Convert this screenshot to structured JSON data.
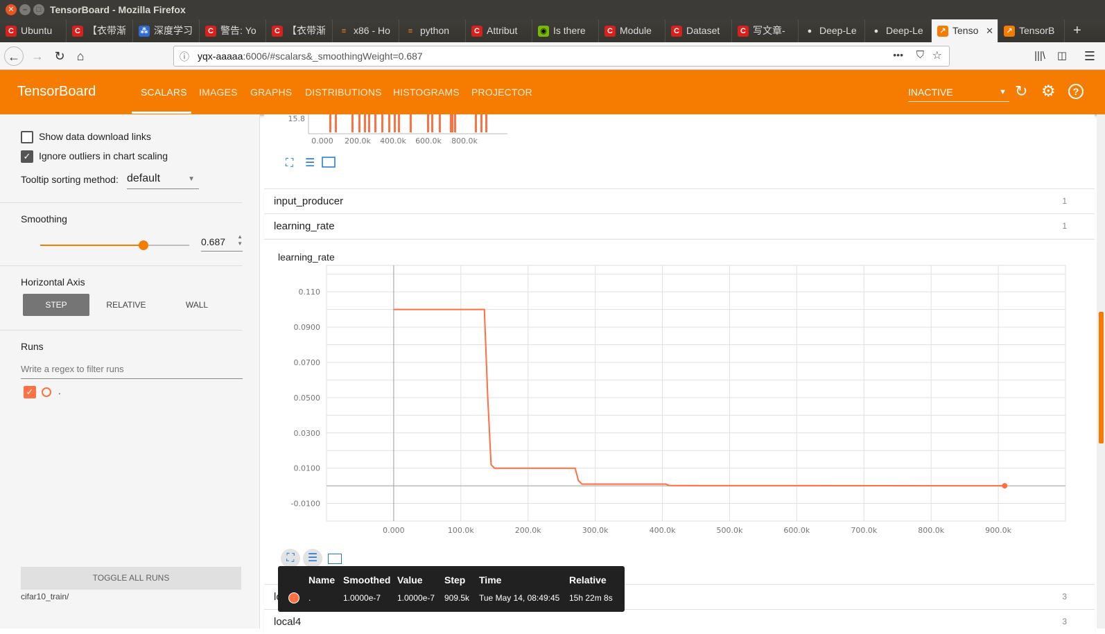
{
  "window": {
    "title": "TensorBoard - Mozilla Firefox"
  },
  "browser": {
    "tabs": [
      {
        "label": "Ubuntu",
        "icon": "csdn-icon"
      },
      {
        "label": "【衣带渐",
        "icon": "csdn-icon"
      },
      {
        "label": "深度学习",
        "icon": "baidu-icon"
      },
      {
        "label": "警告: Yo",
        "icon": "csdn-icon"
      },
      {
        "label": "【衣带渐",
        "icon": "csdn-icon"
      },
      {
        "label": "x86 - Ho",
        "icon": "stackoverflow-icon"
      },
      {
        "label": "python",
        "icon": "stackoverflow-icon"
      },
      {
        "label": "Attribut",
        "icon": "csdn-icon"
      },
      {
        "label": "Is there",
        "icon": "nvidia-icon"
      },
      {
        "label": "Module",
        "icon": "csdn-icon"
      },
      {
        "label": "Dataset",
        "icon": "csdn-icon"
      },
      {
        "label": "写文章-",
        "icon": "csdn-icon"
      },
      {
        "label": "Deep-Le",
        "icon": "github-icon"
      },
      {
        "label": "Deep-Le",
        "icon": "github-icon"
      },
      {
        "label": "Tenso",
        "icon": "tensorboard-icon"
      },
      {
        "label": "TensorB",
        "icon": "tensorboard-icon"
      }
    ],
    "url_host": "yqx-aaaaa",
    "url_rest": ":6006/#scalars&_smoothingWeight=0.687"
  },
  "header": {
    "brand": "TensorBoard",
    "tabs": [
      "SCALARS",
      "IMAGES",
      "GRAPHS",
      "DISTRIBUTIONS",
      "HISTOGRAMS",
      "PROJECTOR"
    ],
    "active_tab": "SCALARS",
    "status": "INACTIVE"
  },
  "sidebar": {
    "show_download_links": "Show data download links",
    "ignore_outliers": "Ignore outliers in chart scaling",
    "tooltip_sort_label": "Tooltip sorting method:",
    "tooltip_sort_value": "default",
    "smoothing_title": "Smoothing",
    "smoothing_value": "0.687",
    "haxis_title": "Horizontal Axis",
    "haxis_options": [
      "STEP",
      "RELATIVE",
      "WALL"
    ],
    "runs_title": "Runs",
    "runs_filter_placeholder": "Write a regex to filter runs",
    "run_name": ".",
    "toggle_all": "TOGGLE ALL RUNS",
    "logdir": "cifar10_train/"
  },
  "categories": [
    {
      "name": "input_producer",
      "count": "1"
    },
    {
      "name": "learning_rate",
      "count": "1"
    },
    {
      "name": "local3",
      "count": "3"
    },
    {
      "name": "local4",
      "count": "3"
    }
  ],
  "top_chart": {
    "y_tick": "15.8",
    "x_ticks": [
      "0.000",
      "200.0k",
      "400.0k",
      "600.0k",
      "800.0k"
    ]
  },
  "chart_data": {
    "type": "line",
    "title": "learning_rate",
    "xlabel": "",
    "ylabel": "",
    "x_ticks": [
      "0.000",
      "100.0k",
      "200.0k",
      "300.0k",
      "400.0k",
      "500.0k",
      "600.0k",
      "700.0k",
      "800.0k",
      "900.0k"
    ],
    "y_ticks": [
      "0.110",
      "0.0900",
      "0.0700",
      "0.0500",
      "0.0300",
      "0.0100",
      "-0.0100"
    ],
    "xlim": [
      -100000,
      1000000
    ],
    "ylim": [
      -0.02,
      0.125
    ],
    "grid": true,
    "series": [
      {
        "color": "#ff7043",
        "x": [
          0,
          135000,
          140000,
          145000,
          150000,
          270000,
          275000,
          280000,
          290000,
          405000,
          410000,
          420000,
          909500
        ],
        "y": [
          0.1,
          0.1,
          0.05,
          0.012,
          0.01,
          0.01,
          0.003,
          0.001,
          0.001,
          0.001,
          0.0002,
          0.0001,
          1e-07
        ]
      }
    ]
  },
  "tooltip": {
    "headers": [
      "Name",
      "Smoothed",
      "Value",
      "Step",
      "Time",
      "Relative"
    ],
    "row": [
      ".",
      "1.0000e-7",
      "1.0000e-7",
      "909.5k",
      "Tue May 14, 08:49:45",
      "15h 22m 8s"
    ]
  },
  "colors": {
    "accent": "#f57c00",
    "series": "#ff7043"
  }
}
